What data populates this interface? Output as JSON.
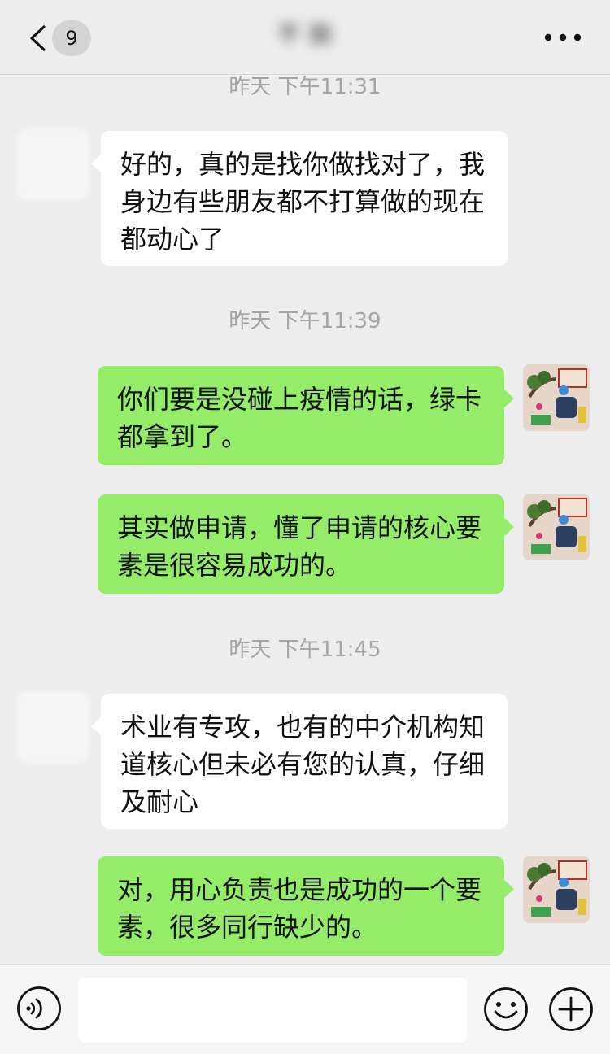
{
  "header": {
    "unread_count": "9",
    "title": "芊 酿"
  },
  "messages": [
    {
      "kind": "timestamp",
      "text": "昨天 下午11:31"
    },
    {
      "kind": "incoming",
      "text": "好的，真的是找你做找对了，我身边有些朋友都不打算做的现在都动心了"
    },
    {
      "kind": "timestamp",
      "text": "昨天 下午11:39"
    },
    {
      "kind": "outgoing",
      "text": "你们要是没碰上疫情的话，绿卡都拿到了。"
    },
    {
      "kind": "outgoing",
      "text": "其实做申请，懂了申请的核心要素是很容易成功的。"
    },
    {
      "kind": "timestamp",
      "text": "昨天 下午11:45"
    },
    {
      "kind": "incoming",
      "text": "术业有专攻，也有的中介机构知道核心但未必有您的认真，仔细及耐心"
    },
    {
      "kind": "outgoing",
      "text": "对，用心负责也是成功的一个要素，很多同行缺少的。"
    }
  ],
  "input_bar": {
    "placeholder": ""
  },
  "colors": {
    "background": "#ededed",
    "bubble_outgoing": "#95ec69",
    "bubble_incoming": "#ffffff",
    "timestamp": "#a5a5a5"
  },
  "icons": {
    "back": "chevron-left-icon",
    "more": "more-dots-icon",
    "voice": "voice-icon",
    "emoji": "emoji-icon",
    "plus": "plus-icon"
  }
}
